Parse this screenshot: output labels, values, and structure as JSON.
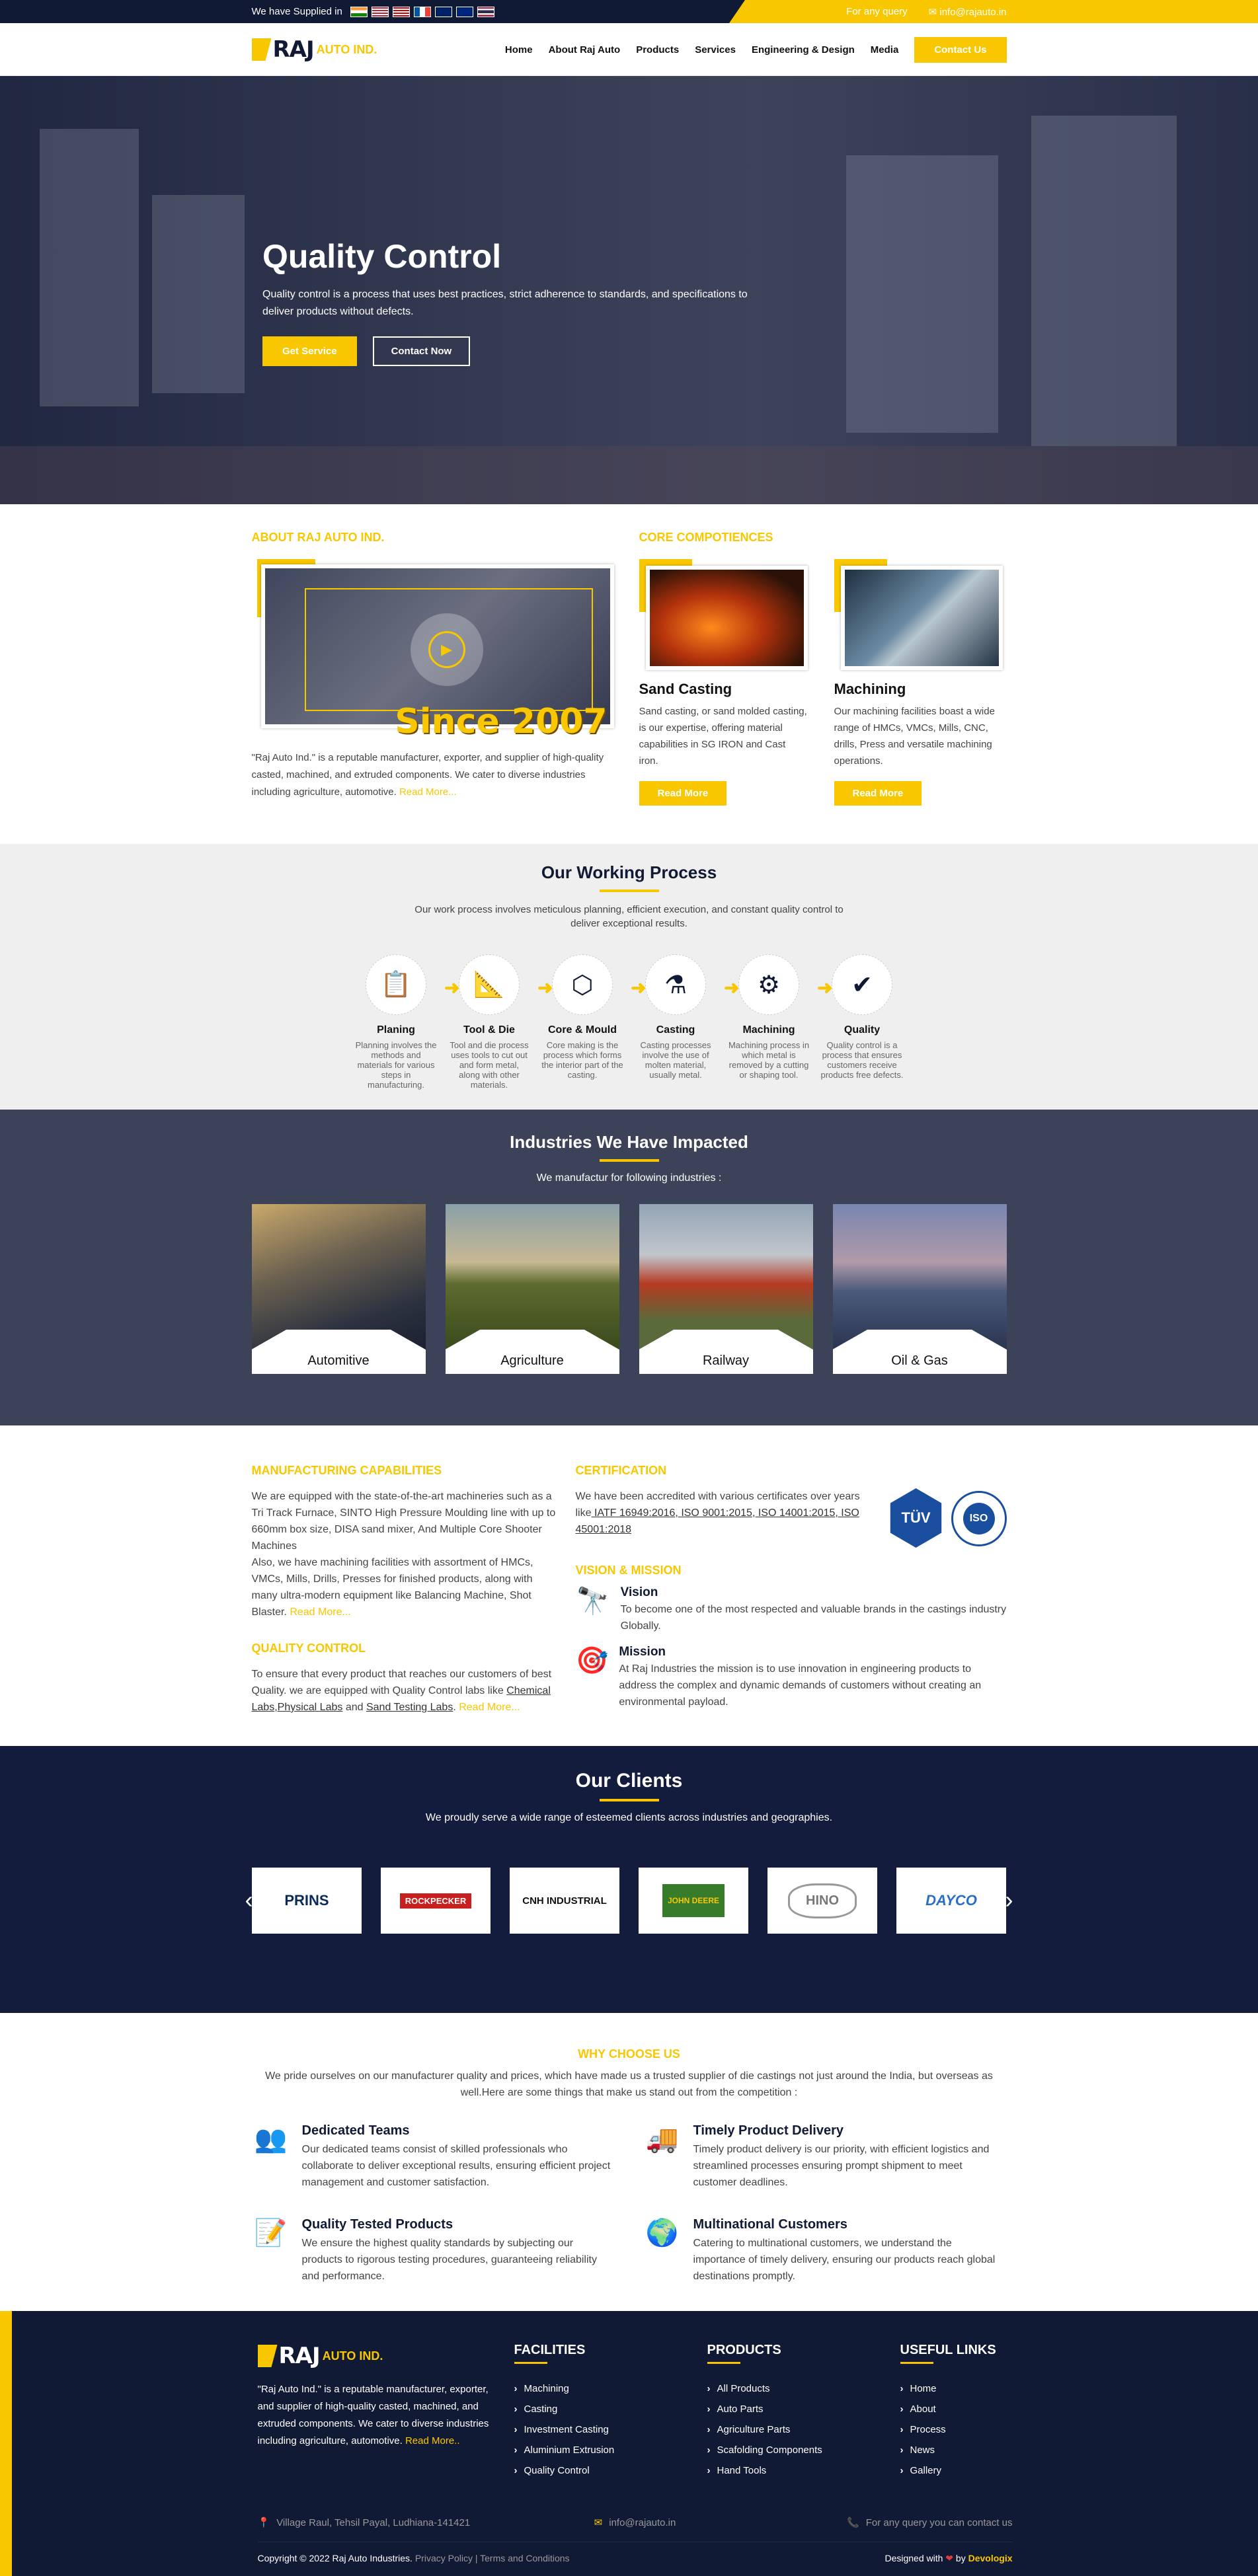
{
  "topbar": {
    "supplied_label": "We have Supplied in",
    "flags": [
      "india",
      "usa",
      "malaysia",
      "france",
      "uk",
      "australia",
      "thailand"
    ],
    "query_label": "For any query",
    "email": "info@rajauto.in"
  },
  "nav": {
    "logo_main": "RAJ",
    "logo_sub": "AUTO IND.",
    "items": [
      "Home",
      "About Raj Auto",
      "Products",
      "Services",
      "Engineering & Design",
      "Media"
    ],
    "contact_label": "Contact Us"
  },
  "hero": {
    "title": "Quality Control",
    "text": "Quality control is a process that uses best practices, strict adherence to standards, and specifications to deliver products without defects.",
    "btn_primary": "Get Service",
    "btn_secondary": "Contact Now"
  },
  "about": {
    "heading": "ABOUT RAJ AUTO IND.",
    "since": "Since 2007",
    "text": "\"Raj Auto Ind.\" is a reputable manufacturer, exporter, and supplier of high-quality casted, machined, and extruded components. We cater to diverse industries including agriculture, automotive.",
    "read_more": "Read More..."
  },
  "competencies": {
    "heading": "CORE COMPOTIENCES",
    "cards": [
      {
        "title": "Sand Casting",
        "text": "Sand casting, or sand molded casting, is our expertise, offering material capabilities in SG IRON and Cast iron.",
        "btn": "Read More"
      },
      {
        "title": "Machining",
        "text": "Our machining facilities boast a wide range of HMCs, VMCs, Mills, CNC, drills, Press and versatile machining operations.",
        "btn": "Read More"
      }
    ]
  },
  "process": {
    "title": "Our Working Process",
    "subtitle": "Our work process involves meticulous planning, efficient execution, and constant quality control to deliver exceptional results.",
    "steps": [
      {
        "title": "Planing",
        "text": "Planning involves the methods and materials for various steps in manufacturing.",
        "icon": "planning-icon"
      },
      {
        "title": "Tool & Die",
        "text": "Tool and die process uses tools to cut out and form metal, along with other materials.",
        "icon": "tool-die-icon"
      },
      {
        "title": "Core & Mould",
        "text": "Core making is the process which forms the interior part of the casting.",
        "icon": "core-mould-icon"
      },
      {
        "title": "Casting",
        "text": "Casting processes involve the use of molten material, usually metal.",
        "icon": "casting-icon"
      },
      {
        "title": "Machining",
        "text": "Machining process in which metal is removed by a cutting or shaping tool.",
        "icon": "machining-icon"
      },
      {
        "title": "Quality",
        "text": "Quality control is a process that ensures customers receive products free defects.",
        "icon": "quality-icon"
      }
    ]
  },
  "industries": {
    "title": "Industries We Have Impacted",
    "subtitle": "We manufactur for following industries :",
    "items": [
      "Automitive",
      "Agriculture",
      "Railway",
      "Oil & Gas"
    ]
  },
  "capabilities": {
    "mfg_heading": "MANUFACTURING CAPABILITIES",
    "mfg_text1": "We are equipped with the state-of-the-art machineries such as a Tri Track Furnace, SINTO High Pressure Moulding line with up to 660mm box size, DISA sand mixer, And Multiple Core Shooter Machines",
    "mfg_text2": "Also, we have machining facilities with assortment of HMCs, VMCs, Mills, Drills, Presses for finished products, along with many ultra-modern equipment like Balancing Machine, Shot Blaster.",
    "read_more": "Read More...",
    "qc_heading": "QUALITY CONTROL",
    "qc_text": "To ensure that every product that reaches our customers of best Quality. we are equipped with Quality Control labs like",
    "qc_links": [
      "Chemical Labs",
      ",Physical Labs",
      " and ",
      "Sand Testing Labs"
    ],
    "cert_heading": "CERTIFICATION",
    "cert_text": "We have been accredited with various certificates over years like",
    "cert_links": [
      " IATF 16949:2016",
      ", ISO 9001:2015",
      ", ISO 14001:2015",
      ", ISO 45001:2018"
    ],
    "badge_tuv": "TÜV",
    "badge_iso": "ISO",
    "vm_heading": "VISION & MISSION",
    "vision_title": "Vision",
    "vision_text": "To become one of the most respected and valuable brands in the castings industry Globally.",
    "mission_title": "Mission",
    "mission_text": "At Raj Industries the mission is to use innovation in engineering products to address the complex and dynamic demands of customers without creating an environmental payload."
  },
  "clients": {
    "title": "Our Clients",
    "subtitle": "We proudly serve a wide range of esteemed clients across industries and geographies.",
    "logos": [
      "PRINS",
      "ROCKPECKER",
      "CNH INDUSTRIAL",
      "JOHN DEERE",
      "HINO",
      "DAYCO"
    ]
  },
  "why": {
    "heading": "WHY CHOOSE US",
    "subtitle": "We pride ourselves on our manufacturer quality and prices, which have made us a trusted supplier of die castings not just around the India, but overseas as well.Here are some things that make us stand out from the competition :",
    "items": [
      {
        "title": "Dedicated Teams",
        "text": "Our dedicated teams consist of skilled professionals who collaborate to deliver exceptional results, ensuring efficient project management and customer satisfaction.",
        "icon": "team-icon"
      },
      {
        "title": "Timely Product Delivery",
        "text": "Timely product delivery is our priority, with efficient logistics and streamlined processes ensuring prompt shipment to meet customer deadlines.",
        "icon": "delivery-icon"
      },
      {
        "title": "Quality Tested Products",
        "text": "We ensure the highest quality standards by subjecting our products to rigorous testing procedures, guaranteeing reliability and performance.",
        "icon": "checklist-icon"
      },
      {
        "title": "Multinational Customers",
        "text": "Catering to multinational customers, we understand the importance of timely delivery, ensuring our products reach global destinations promptly.",
        "icon": "globe-icon"
      }
    ]
  },
  "footer": {
    "about": "\"Raj Auto Ind.\" is a reputable manufacturer, exporter, and supplier of high-quality casted, machined, and extruded components. We cater to diverse industries including agriculture, automotive.",
    "read_more": "Read More..",
    "facilities_title": "FACILITIES",
    "facilities": [
      "Machining",
      "Casting",
      "Investment Casting",
      "Aluminium Extrusion",
      "Quality Control"
    ],
    "products_title": "PRODUCTS",
    "products": [
      "All Products",
      "Auto Parts",
      "Agriculture Parts",
      "Scafolding Components",
      "Hand Tools"
    ],
    "links_title": "USEFUL LINKS",
    "links": [
      "Home",
      "About",
      "Process",
      "News",
      "Gallery"
    ],
    "address": "Village Raul, Tehsil Payal, Ludhiana-141421",
    "email": "info@rajauto.in",
    "query": "For any query you can contact us",
    "copyright": "Copyright © 2022 Raj Auto Industries.",
    "legal": "Privacy Policy | Terms and Conditions",
    "designed_by": "Designed with",
    "designed_by_2": "by",
    "designer": "Devologix"
  },
  "colors": {
    "accent": "#f9c700",
    "navy": "#111a35",
    "slate": "#3c4359"
  }
}
